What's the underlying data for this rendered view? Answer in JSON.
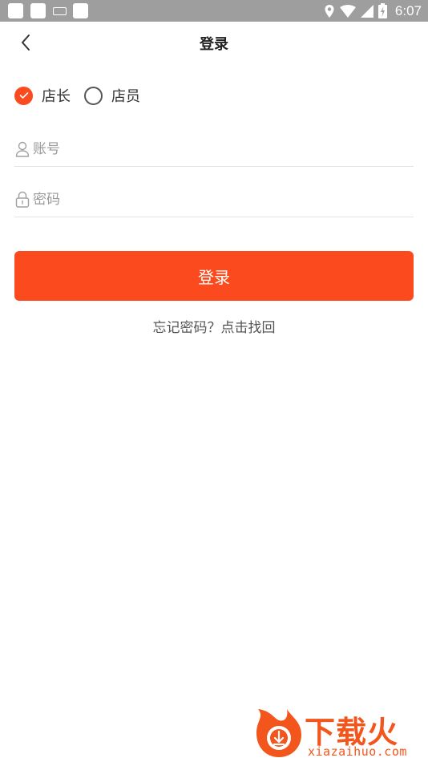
{
  "status_bar": {
    "time": "6:07"
  },
  "nav": {
    "title": "登录"
  },
  "roles": {
    "options": [
      {
        "label": "店长",
        "selected": true
      },
      {
        "label": "店员",
        "selected": false
      }
    ]
  },
  "form": {
    "account_placeholder": "账号",
    "password_placeholder": "密码",
    "login_label": "登录",
    "forgot_text": "忘记密码？点击找回"
  },
  "watermark": {
    "brand": "下载火",
    "domain": "xiazaihuo.com"
  },
  "colors": {
    "accent": "#fc4a1f",
    "status_bar": "#9e9e9e"
  }
}
